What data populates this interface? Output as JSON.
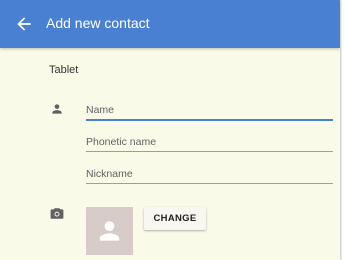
{
  "header": {
    "title": "Add new contact",
    "background": "#4a80d1",
    "back_icon": "arrow-back-icon"
  },
  "form": {
    "account_label": "Tablet",
    "fields": [
      {
        "placeholder": "Name",
        "value": "",
        "focused": true
      },
      {
        "placeholder": "Phonetic name",
        "value": ""
      },
      {
        "placeholder": "Nickname",
        "value": ""
      }
    ],
    "photo": {
      "section_icon": "camera-icon",
      "placeholder_icon": "person-placeholder-icon",
      "change_label": "CHANGE"
    }
  },
  "colors": {
    "accent": "#4a80d1",
    "background": "#fafae9",
    "photo_placeholder": "#d7ccc8"
  }
}
